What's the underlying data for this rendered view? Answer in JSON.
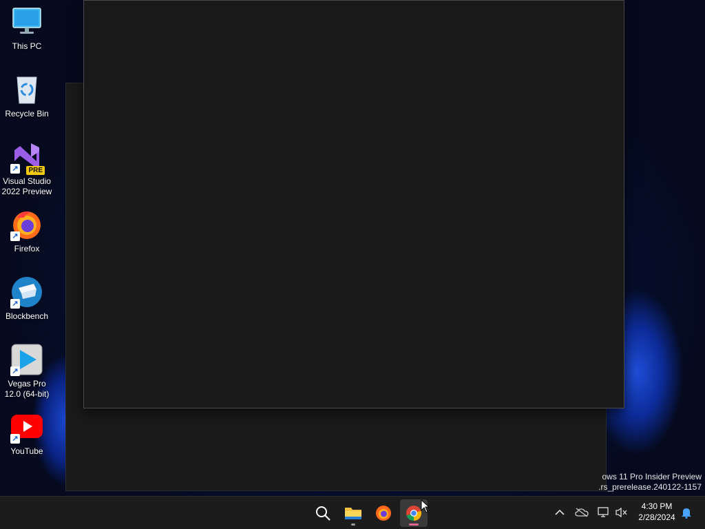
{
  "desktop": {
    "icons": [
      {
        "label": "This PC",
        "icon": "monitor-icon"
      },
      {
        "label": "Recycle Bin",
        "icon": "recycle-bin-icon"
      },
      {
        "label": "Visual Studio\n2022 Preview",
        "icon": "visual-studio-icon",
        "badge": "PRE"
      },
      {
        "label": "Firefox",
        "icon": "firefox-icon"
      },
      {
        "label": "Blockbench",
        "icon": "blockbench-icon"
      },
      {
        "label": "Vegas Pro\n12.0 (64-bit)",
        "icon": "vegas-pro-icon"
      },
      {
        "label": "YouTube",
        "icon": "youtube-icon"
      }
    ],
    "shortcut_arrow": "↗"
  },
  "watermark": {
    "line1": "ows 11 Pro Insider Preview",
    "line2": ".rs_prerelease.240122-1157"
  },
  "taskbar": {
    "apps": [
      {
        "name": "Search",
        "icon": "search-icon"
      },
      {
        "name": "File Explorer",
        "icon": "folder-icon"
      },
      {
        "name": "Firefox",
        "icon": "firefox-icon"
      },
      {
        "name": "Google Chrome",
        "icon": "chrome-icon",
        "active": true
      }
    ],
    "tray": {
      "time": "4:30 PM",
      "date": "2/28/2024"
    }
  },
  "colors": {
    "taskbar_bg": "#1c1c1c",
    "window_bg": "#191919",
    "active_indicator": "#e06a8e"
  }
}
